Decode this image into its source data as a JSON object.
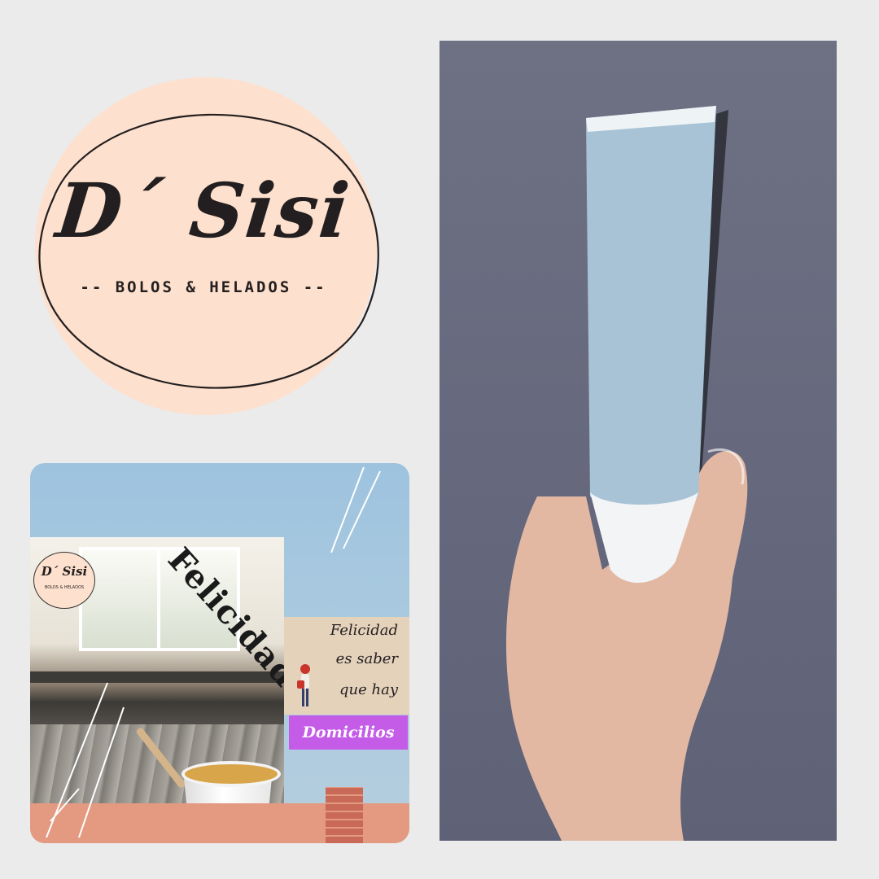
{
  "logo": {
    "title": "D´ Sisi",
    "subtitle": "-- BOLOS & HELADOS --",
    "blob_color": "#fde0cd",
    "ink_color": "#231f20"
  },
  "promo": {
    "title": "Felicidad?",
    "note_lines": [
      "Felicidad",
      "es saber",
      "que hay"
    ],
    "badge": "Domicilios",
    "badge_color": "#c45ce8",
    "mini_logo_title": "D´ Sisi",
    "mini_logo_subtitle": "BOLOS & HELADOS"
  },
  "product_photo": {
    "subject": "hand-holding-ice-pop"
  }
}
